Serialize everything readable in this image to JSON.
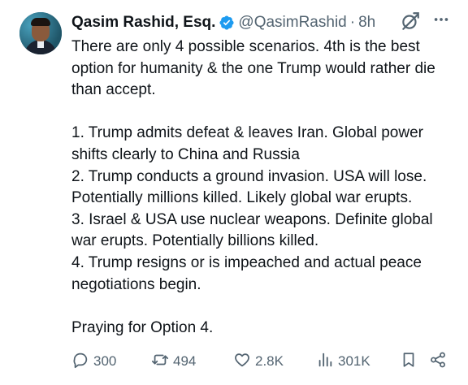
{
  "author": {
    "name": "Qasim Rashid, Esq.",
    "handle": "@QasimRashid",
    "separator": "·",
    "time": "8h"
  },
  "tweet": {
    "lines": [
      "There are only 4 possible scenarios. 4th is the best option for humanity & the one Trump would rather die than accept.",
      "",
      "1. Trump admits defeat & leaves Iran. Global power shifts clearly to China and Russia",
      "2. Trump conducts a ground invasion. USA will lose. Potentially millions killed. Likely global war erupts.",
      "3. Israel & USA use nuclear weapons. Definite global war erupts. Potentially billions killed.",
      "4. Trump resigns or is impeached and actual peace negotiations begin.",
      "",
      "Praying for Option 4."
    ]
  },
  "actions": {
    "replies": "300",
    "reposts": "494",
    "likes": "2.8K",
    "views": "301K"
  },
  "icons": {
    "verified": "verified-badge-icon",
    "grok": "grok-icon",
    "more": "more-icon",
    "reply": "reply-icon",
    "repost": "repost-icon",
    "like": "like-icon",
    "views": "views-icon",
    "bookmark": "bookmark-icon",
    "share": "share-icon"
  },
  "colors": {
    "text": "#0f1419",
    "secondary": "#536471",
    "verified": "#1d9bf0"
  }
}
